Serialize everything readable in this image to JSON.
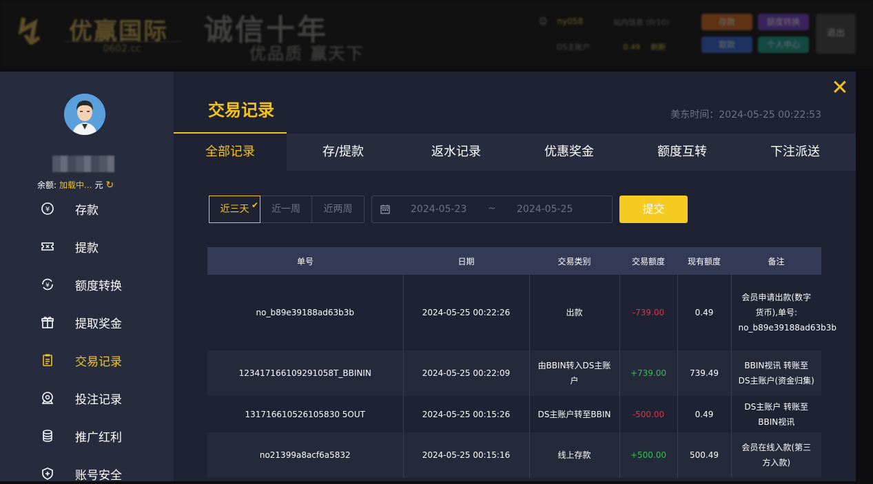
{
  "header": {
    "logo_name": "优赢国际",
    "logo_domain": "0602.cc",
    "slogan_top": "诚信十年",
    "slogan_bottom": "优品质 赢天下",
    "username": "ny058",
    "messages": "站内信息 (0/10)",
    "main_account_label": "DS主账户",
    "main_account_value": "0.49",
    "refresh_label": "刷新",
    "buttons": {
      "deposit": "存款",
      "transfer": "额度转换",
      "withdraw": "取款",
      "personal": "个人中心",
      "logout": "退出"
    },
    "colors": {
      "deposit": "#b85a1c",
      "transfer": "#6a3ab0",
      "withdraw": "#2c5ab8",
      "personal": "#1a8a7a"
    }
  },
  "sidebar": {
    "balance_label": "余额:",
    "balance_value": "加载中...",
    "balance_unit": "元",
    "items": [
      {
        "label": "存款",
        "icon": "yuan-circle-icon"
      },
      {
        "label": "提款",
        "icon": "ticket-icon"
      },
      {
        "label": "额度转换",
        "icon": "exchange-icon"
      },
      {
        "label": "提取奖金",
        "icon": "gift-icon"
      },
      {
        "label": "交易记录",
        "icon": "clipboard-icon",
        "active": true
      },
      {
        "label": "投注记录",
        "icon": "bet-icon"
      },
      {
        "label": "推广红利",
        "icon": "coins-icon"
      },
      {
        "label": "账号安全",
        "icon": "shield-icon"
      }
    ]
  },
  "main": {
    "title": "交易记录",
    "time_label": "美东时间：",
    "time_value": "2024-05-25 00:22:53",
    "tabs": [
      "全部记录",
      "存/提款",
      "返水记录",
      "优惠奖金",
      "额度互转",
      "下注派送"
    ],
    "range": [
      "近三天",
      "近一周",
      "近两周"
    ],
    "date_from": "2024-05-23",
    "date_sep": "~",
    "date_to": "2024-05-25",
    "submit": "提交"
  },
  "table": {
    "headers": [
      "单号",
      "日期",
      "交易类别",
      "交易额度",
      "现有额度",
      "备注"
    ],
    "rows": [
      {
        "id": "no_b89e39188ad63b3b",
        "date": "2024-05-25 00:22:26",
        "type": "出款",
        "amount": "-739.00",
        "balance": "0.49",
        "note": "会员申请出款(数字货币),单号: no_b89e39188ad63b3b"
      },
      {
        "id": "123417166109291058T_BBININ",
        "date": "2024-05-25 00:22:09",
        "type": "由BBIN转入DS主账户",
        "amount": "+739.00",
        "balance": "739.49",
        "note": "BBIN视讯 转账至 DS主账户(资金归集)"
      },
      {
        "id": "131716610526105830 5OUT",
        "date": "2024-05-25 00:15:26",
        "type": "DS主账户转至BBIN",
        "amount": "-500.00",
        "balance": "0.49",
        "note": "DS主账户 转账至 BBIN视讯"
      },
      {
        "id": "no21399a8acf6a5832",
        "date": "2024-05-25 00:15:16",
        "type": "线上存款",
        "amount": "+500.00",
        "balance": "500.49",
        "note": "会员在线入款(第三方入款)"
      }
    ]
  }
}
